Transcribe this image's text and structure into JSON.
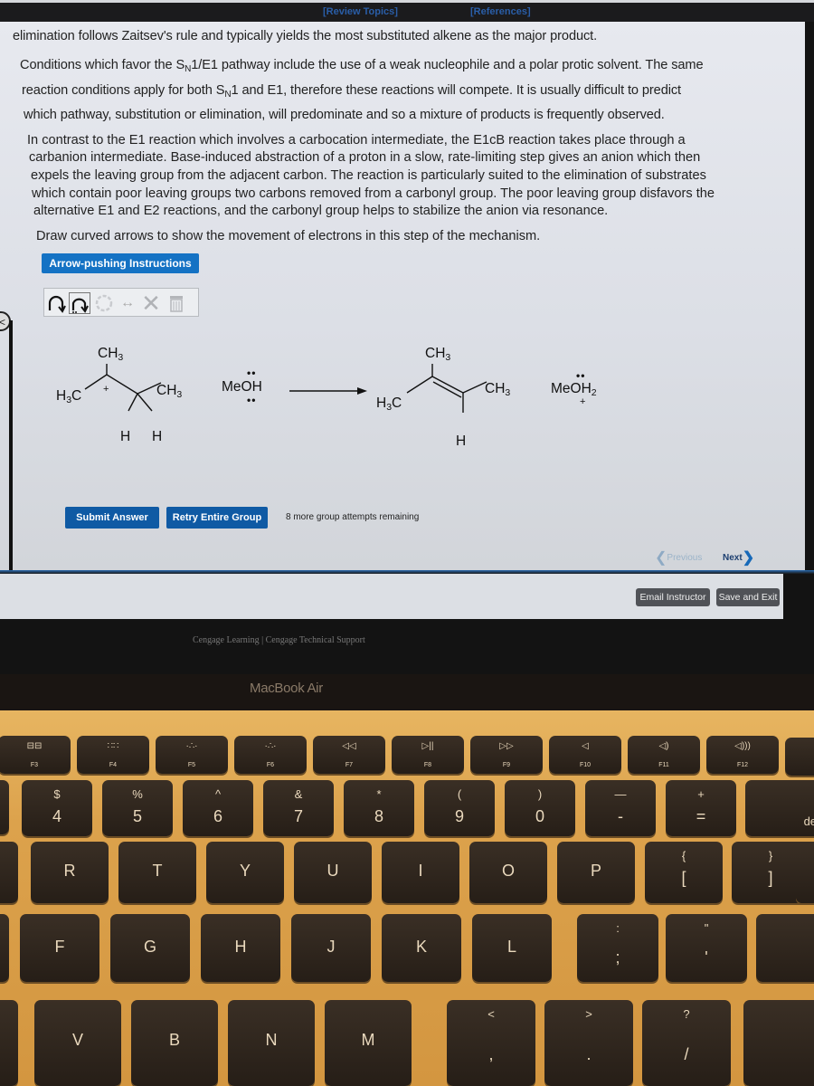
{
  "header": {
    "review_topics": "[Review Topics]",
    "references": "[References]"
  },
  "intro": {
    "line1": "elimination follows Zaitsev's rule and typically yields the most substituted alkene as the major product.",
    "p2_line1_a": "Conditions which favor the S",
    "p2_line1_sub": "N",
    "p2_line1_b": "1/E1 pathway include the use of a weak nucleophile and a polar protic solvent. The same",
    "p2_line2_a": "reaction conditions apply for both S",
    "p2_line2_sub": "N",
    "p2_line2_b": "1 and E1, therefore these reactions will compete. It is usually difficult to predict",
    "p2_line3": "which pathway, substitution or elimination, will predominate and so a mixture of products is frequently observed."
  },
  "e1cb": {
    "lines": [
      "In contrast to the E1 reaction which involves a carbocation intermediate, the E1cB reaction takes place through a",
      "carbanion intermediate. Base-induced abstraction of a proton in a slow, rate-limiting step gives an anion which then",
      "expels the leaving group from the adjacent carbon. The reaction is particularly suited to the elimination of substrates",
      "which contain poor leaving groups two carbons removed from a carbonyl group. The poor leaving group disfavors the",
      "alternative E1 and E2 reactions, and the carbonyl group helps to stabilize the anion via resonance."
    ]
  },
  "question": {
    "prompt": "Draw curved arrows to show the movement of electrons in this step of the mechanism.",
    "instructions_button": "Arrow-pushing Instructions"
  },
  "toolbar": {
    "tools": [
      {
        "name": "single-arrow-tool",
        "icon": "curved-arrow"
      },
      {
        "name": "double-arrow-tool",
        "icon": "curved-arrow-lone-pair"
      },
      {
        "name": "ring-tool",
        "icon": "ring"
      },
      {
        "name": "resonance-tool",
        "icon": "double-headed-arrow"
      },
      {
        "name": "delete-tool",
        "icon": "x"
      },
      {
        "name": "trash-tool",
        "icon": "trash"
      }
    ]
  },
  "mechanism": {
    "reactant": {
      "top_methyl": "CH",
      "top_methyl_sub": "3",
      "left_methyl": "H",
      "left_methyl_sub": "3",
      "left_methyl_c": "C",
      "right_methyl": "CH",
      "right_methyl_sub": "3",
      "charge": "+",
      "h1": "H",
      "h2": "H"
    },
    "reagent": {
      "text": "MeOH",
      "lone_pairs": "••"
    },
    "product": {
      "top_methyl": "CH",
      "top_methyl_sub": "3",
      "left_methyl": "H",
      "left_methyl_sub": "3",
      "left_methyl_c": "C",
      "right_methyl": "CH",
      "right_methyl_sub": "3",
      "h": "H"
    },
    "byproduct": {
      "text": "MeOH",
      "sub": "2",
      "charge": "+",
      "lone_pairs": "••"
    }
  },
  "actions": {
    "submit": "Submit Answer",
    "retry": "Retry Entire Group",
    "attempts": "8 more group attempts remaining",
    "previous": "Previous",
    "next": "Next",
    "email": "Email Instructor",
    "save_exit": "Save and Exit"
  },
  "footer": {
    "credits": "Cengage Learning  |  Cengage Technical Support"
  },
  "laptop": {
    "model": "MacBook Air",
    "fkeys": [
      {
        "icon": "⊟⊟",
        "label": "F3"
      },
      {
        "icon": "∷∷",
        "label": "F4"
      },
      {
        "icon": "·∴·",
        "label": "F5"
      },
      {
        "icon": "·∴·",
        "label": "F6"
      },
      {
        "icon": "◁◁",
        "label": "F7"
      },
      {
        "icon": "▷||",
        "label": "F8"
      },
      {
        "icon": "▷▷",
        "label": "F9"
      },
      {
        "icon": "◁",
        "label": "F10"
      },
      {
        "icon": "◁)",
        "label": "F11"
      },
      {
        "icon": "◁)))",
        "label": "F12"
      }
    ],
    "number_row": [
      {
        "top": "$",
        "bottom": "4"
      },
      {
        "top": "%",
        "bottom": "5"
      },
      {
        "top": "^",
        "bottom": "6"
      },
      {
        "top": "&",
        "bottom": "7"
      },
      {
        "top": "*",
        "bottom": "8"
      },
      {
        "top": "(",
        "bottom": "9"
      },
      {
        "top": ")",
        "bottom": "0"
      },
      {
        "top": "—",
        "bottom": "-"
      },
      {
        "top": "+",
        "bottom": "="
      }
    ],
    "delete_key": "delete",
    "qwerty_row": [
      "R",
      "T",
      "Y",
      "U",
      "I",
      "O",
      "P"
    ],
    "bracket_keys": [
      {
        "top": "{",
        "bottom": "["
      },
      {
        "top": "}",
        "bottom": "]"
      }
    ],
    "home_row": [
      "F",
      "G",
      "H",
      "J",
      "K",
      "L"
    ],
    "home_punct": [
      {
        "top": ":",
        "bottom": ";"
      },
      {
        "top": "\"",
        "bottom": "'"
      }
    ],
    "bottom_row": [
      "V",
      "B",
      "N",
      "M"
    ],
    "bottom_punct": [
      {
        "top": "<",
        "bottom": ","
      },
      {
        "top": ">",
        "bottom": "."
      },
      {
        "top": "?",
        "bottom": "/"
      }
    ]
  }
}
